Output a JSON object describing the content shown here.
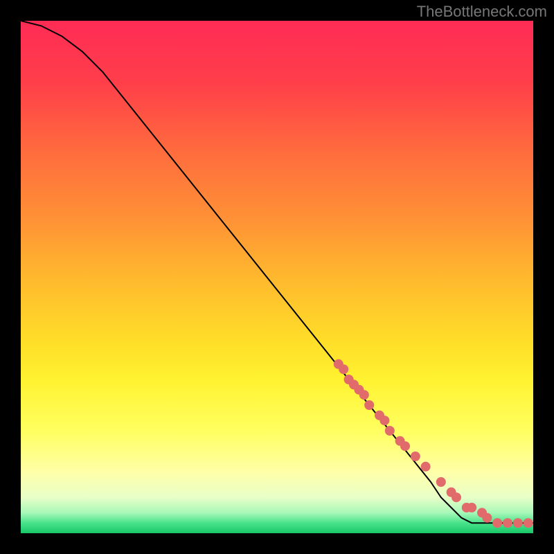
{
  "watermark": "TheBottleneck.com",
  "chart_data": {
    "type": "line",
    "title": "",
    "xlabel": "",
    "ylabel": "",
    "xlim": [
      0,
      100
    ],
    "ylim": [
      0,
      100
    ],
    "grid": false,
    "series": [
      {
        "name": "curve",
        "color": "#000000",
        "kind": "line",
        "x": [
          0,
          4,
          8,
          12,
          16,
          20,
          24,
          28,
          32,
          36,
          40,
          44,
          48,
          52,
          56,
          60,
          64,
          68,
          72,
          76,
          80,
          82,
          84,
          86,
          88,
          90,
          92,
          94,
          96,
          98,
          100
        ],
        "y": [
          100,
          99,
          97,
          94,
          90,
          85,
          80,
          75,
          70,
          65,
          60,
          55,
          50,
          45,
          40,
          35,
          30,
          25,
          20,
          15,
          10,
          7,
          5,
          3,
          2,
          2,
          2,
          2,
          2,
          2,
          2
        ]
      },
      {
        "name": "markers",
        "color": "#E16A6A",
        "kind": "scatter",
        "x": [
          62,
          63,
          64,
          65,
          66,
          67,
          68,
          70,
          71,
          72,
          74,
          75,
          77,
          79,
          82,
          84,
          85,
          87,
          88,
          90,
          91,
          93,
          95,
          97,
          99
        ],
        "y": [
          33,
          32,
          30,
          29,
          28,
          27,
          25,
          23,
          22,
          20,
          18,
          17,
          15,
          13,
          10,
          8,
          7,
          5,
          5,
          4,
          3,
          2,
          2,
          2,
          2
        ]
      }
    ],
    "gradient_stops": [
      {
        "offset": 0.0,
        "color": "#FF2C55"
      },
      {
        "offset": 0.12,
        "color": "#FF3E4A"
      },
      {
        "offset": 0.25,
        "color": "#FF6A3E"
      },
      {
        "offset": 0.38,
        "color": "#FF8F36"
      },
      {
        "offset": 0.5,
        "color": "#FFB82E"
      },
      {
        "offset": 0.62,
        "color": "#FFDC28"
      },
      {
        "offset": 0.7,
        "color": "#FFF230"
      },
      {
        "offset": 0.8,
        "color": "#FFFF60"
      },
      {
        "offset": 0.88,
        "color": "#FFFFA8"
      },
      {
        "offset": 0.93,
        "color": "#E8FFC8"
      },
      {
        "offset": 0.96,
        "color": "#A8F8B8"
      },
      {
        "offset": 0.98,
        "color": "#49E38C"
      },
      {
        "offset": 1.0,
        "color": "#18C768"
      }
    ]
  }
}
